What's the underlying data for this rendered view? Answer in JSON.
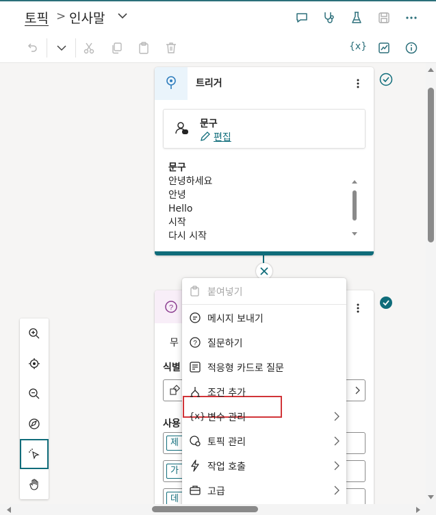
{
  "breadcrumb": {
    "root": "토픽",
    "separator": ">",
    "current": "인사말"
  },
  "header_icons": [
    "chat-icon",
    "stethoscope-icon",
    "flask-icon",
    "save-icon",
    "more-icon"
  ],
  "toolbar": {
    "variables_label": "{x}"
  },
  "trigger_card": {
    "title": "트리거",
    "phrases_box": {
      "title": "문구",
      "edit_label": "편집"
    },
    "list_title": "문구",
    "phrases": [
      "안녕하세요",
      "안녕",
      "Hello",
      "시작",
      "다시 시작"
    ]
  },
  "question_card": {
    "partial_text_1": "무",
    "label_identify": "식별",
    "label_use": "사용",
    "chip_1": "제",
    "chip_2": "가",
    "chip_3": "데"
  },
  "context_menu": {
    "items": [
      {
        "label": "붙여넣기",
        "icon": "paste-icon",
        "disabled": true,
        "submenu": false
      },
      {
        "label": "메시지 보내기",
        "icon": "message-icon",
        "disabled": false,
        "submenu": false
      },
      {
        "label": "질문하기",
        "icon": "question-icon",
        "disabled": false,
        "submenu": false,
        "highlighted": true
      },
      {
        "label": "적응형 카드로 질문",
        "icon": "adaptive-card-icon",
        "disabled": false,
        "submenu": false
      },
      {
        "label": "조건 추가",
        "icon": "branch-icon",
        "disabled": false,
        "submenu": false
      },
      {
        "label": "변수 관리",
        "icon": "variable-icon",
        "disabled": false,
        "submenu": true
      },
      {
        "label": "토픽 관리",
        "icon": "topic-icon",
        "disabled": false,
        "submenu": true
      },
      {
        "label": "작업 호출",
        "icon": "lightning-icon",
        "disabled": false,
        "submenu": true
      },
      {
        "label": "고급",
        "icon": "briefcase-icon",
        "disabled": false,
        "submenu": true
      }
    ]
  },
  "zoom_tools": [
    "zoom-in-icon",
    "fit-view-icon",
    "zoom-out-icon",
    "minimap-icon",
    "select-icon",
    "pan-icon"
  ],
  "colors": {
    "accent": "#0f6c7a",
    "highlight_border": "#d13438",
    "canvas_bg": "#f6f5f4"
  }
}
